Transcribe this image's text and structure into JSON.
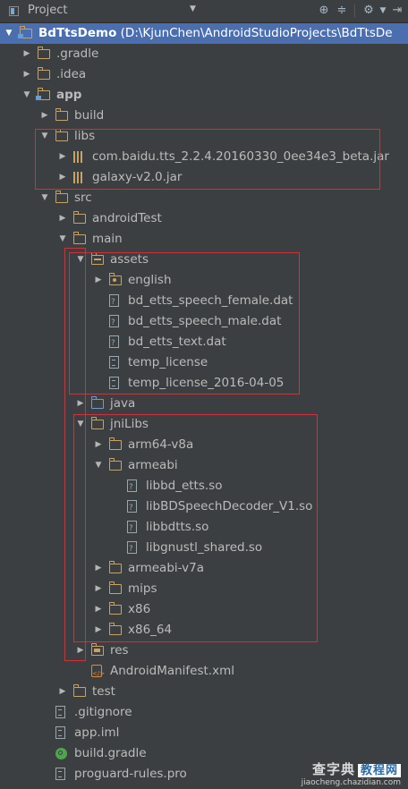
{
  "toolbar": {
    "title": "Project",
    "dropdown_icon": "triangle-down-icon",
    "buttons": [
      "target-icon",
      "collapse-all-icon",
      "gear-icon",
      "hide-icon"
    ]
  },
  "tree": [
    {
      "depth": 0,
      "arrow": "down",
      "icon": "module",
      "label": "BdTtsDemo",
      "bold": true,
      "suffix": " (D:\\KjunChen\\AndroidStudioProjects\\BdTtsDe",
      "selected": true
    },
    {
      "depth": 1,
      "arrow": "right",
      "icon": "folder",
      "label": ".gradle"
    },
    {
      "depth": 1,
      "arrow": "right",
      "icon": "folder",
      "label": ".idea"
    },
    {
      "depth": 1,
      "arrow": "down",
      "icon": "module",
      "label": "app",
      "bold": true
    },
    {
      "depth": 2,
      "arrow": "right",
      "icon": "folder",
      "label": "build"
    },
    {
      "depth": 2,
      "arrow": "down",
      "icon": "folder",
      "label": "libs"
    },
    {
      "depth": 3,
      "arrow": "right",
      "icon": "jar",
      "label": "com.baidu.tts_2.2.4.20160330_0ee34e3_beta.jar"
    },
    {
      "depth": 3,
      "arrow": "right",
      "icon": "jar",
      "label": "galaxy-v2.0.jar"
    },
    {
      "depth": 2,
      "arrow": "down",
      "icon": "folder",
      "label": "src"
    },
    {
      "depth": 3,
      "arrow": "right",
      "icon": "folder",
      "label": "androidTest"
    },
    {
      "depth": 3,
      "arrow": "down",
      "icon": "folder",
      "label": "main"
    },
    {
      "depth": 4,
      "arrow": "down",
      "icon": "res-assets",
      "label": "assets"
    },
    {
      "depth": 5,
      "arrow": "right",
      "icon": "pkg",
      "label": "english"
    },
    {
      "depth": 5,
      "arrow": "",
      "icon": "unknown",
      "label": "bd_etts_speech_female.dat"
    },
    {
      "depth": 5,
      "arrow": "",
      "icon": "unknown",
      "label": "bd_etts_speech_male.dat"
    },
    {
      "depth": 5,
      "arrow": "",
      "icon": "unknown",
      "label": "bd_etts_text.dat"
    },
    {
      "depth": 5,
      "arrow": "",
      "icon": "text",
      "label": "temp_license"
    },
    {
      "depth": 5,
      "arrow": "",
      "icon": "text",
      "label": "temp_license_2016-04-05"
    },
    {
      "depth": 4,
      "arrow": "right",
      "icon": "blue",
      "label": "java"
    },
    {
      "depth": 4,
      "arrow": "down",
      "icon": "folder",
      "label": "jniLibs"
    },
    {
      "depth": 5,
      "arrow": "right",
      "icon": "folder",
      "label": "arm64-v8a"
    },
    {
      "depth": 5,
      "arrow": "down",
      "icon": "folder",
      "label": "armeabi"
    },
    {
      "depth": 6,
      "arrow": "",
      "icon": "unknown",
      "label": "libbd_etts.so"
    },
    {
      "depth": 6,
      "arrow": "",
      "icon": "unknown",
      "label": "libBDSpeechDecoder_V1.so"
    },
    {
      "depth": 6,
      "arrow": "",
      "icon": "unknown",
      "label": "libbdtts.so"
    },
    {
      "depth": 6,
      "arrow": "",
      "icon": "unknown",
      "label": "libgnustl_shared.so"
    },
    {
      "depth": 5,
      "arrow": "right",
      "icon": "folder",
      "label": "armeabi-v7a"
    },
    {
      "depth": 5,
      "arrow": "right",
      "icon": "folder",
      "label": "mips"
    },
    {
      "depth": 5,
      "arrow": "right",
      "icon": "folder",
      "label": "x86"
    },
    {
      "depth": 5,
      "arrow": "right",
      "icon": "folder",
      "label": "x86_64"
    },
    {
      "depth": 4,
      "arrow": "right",
      "icon": "res",
      "label": "res"
    },
    {
      "depth": 4,
      "arrow": "",
      "icon": "xml",
      "label": "AndroidManifest.xml"
    },
    {
      "depth": 3,
      "arrow": "right",
      "icon": "folder",
      "label": "test"
    },
    {
      "depth": 2,
      "arrow": "",
      "icon": "text",
      "label": ".gitignore"
    },
    {
      "depth": 2,
      "arrow": "",
      "icon": "text",
      "label": "app.iml"
    },
    {
      "depth": 2,
      "arrow": "",
      "icon": "gradle",
      "label": "build.gradle"
    },
    {
      "depth": 2,
      "arrow": "",
      "icon": "text",
      "label": "proguard-rules.pro"
    }
  ],
  "watermark": {
    "line1_a": "查字典",
    "line1_b": "教程网",
    "line2": "jiaocheng.chazidian.com"
  },
  "colors": {
    "background": "#3c3f41",
    "selection": "#4b6eaf",
    "highlight_box": "#d42f3a",
    "folder": "#c7a265"
  }
}
